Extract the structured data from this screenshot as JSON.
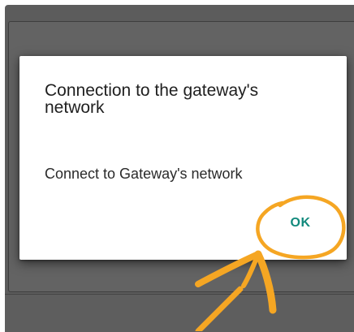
{
  "dialog": {
    "title": "Connection to the gateway's network",
    "message": "Connect to Gateway's network",
    "ok_label": "OK"
  },
  "colors": {
    "accent": "#11897c",
    "annotation": "#f5a623",
    "scrim": "#5c5c5c",
    "dialog_background": "#ffffff"
  },
  "annotation": {
    "circle_icon": "hand-drawn-circle-icon",
    "arrow_icon": "hand-drawn-arrow-icon"
  }
}
